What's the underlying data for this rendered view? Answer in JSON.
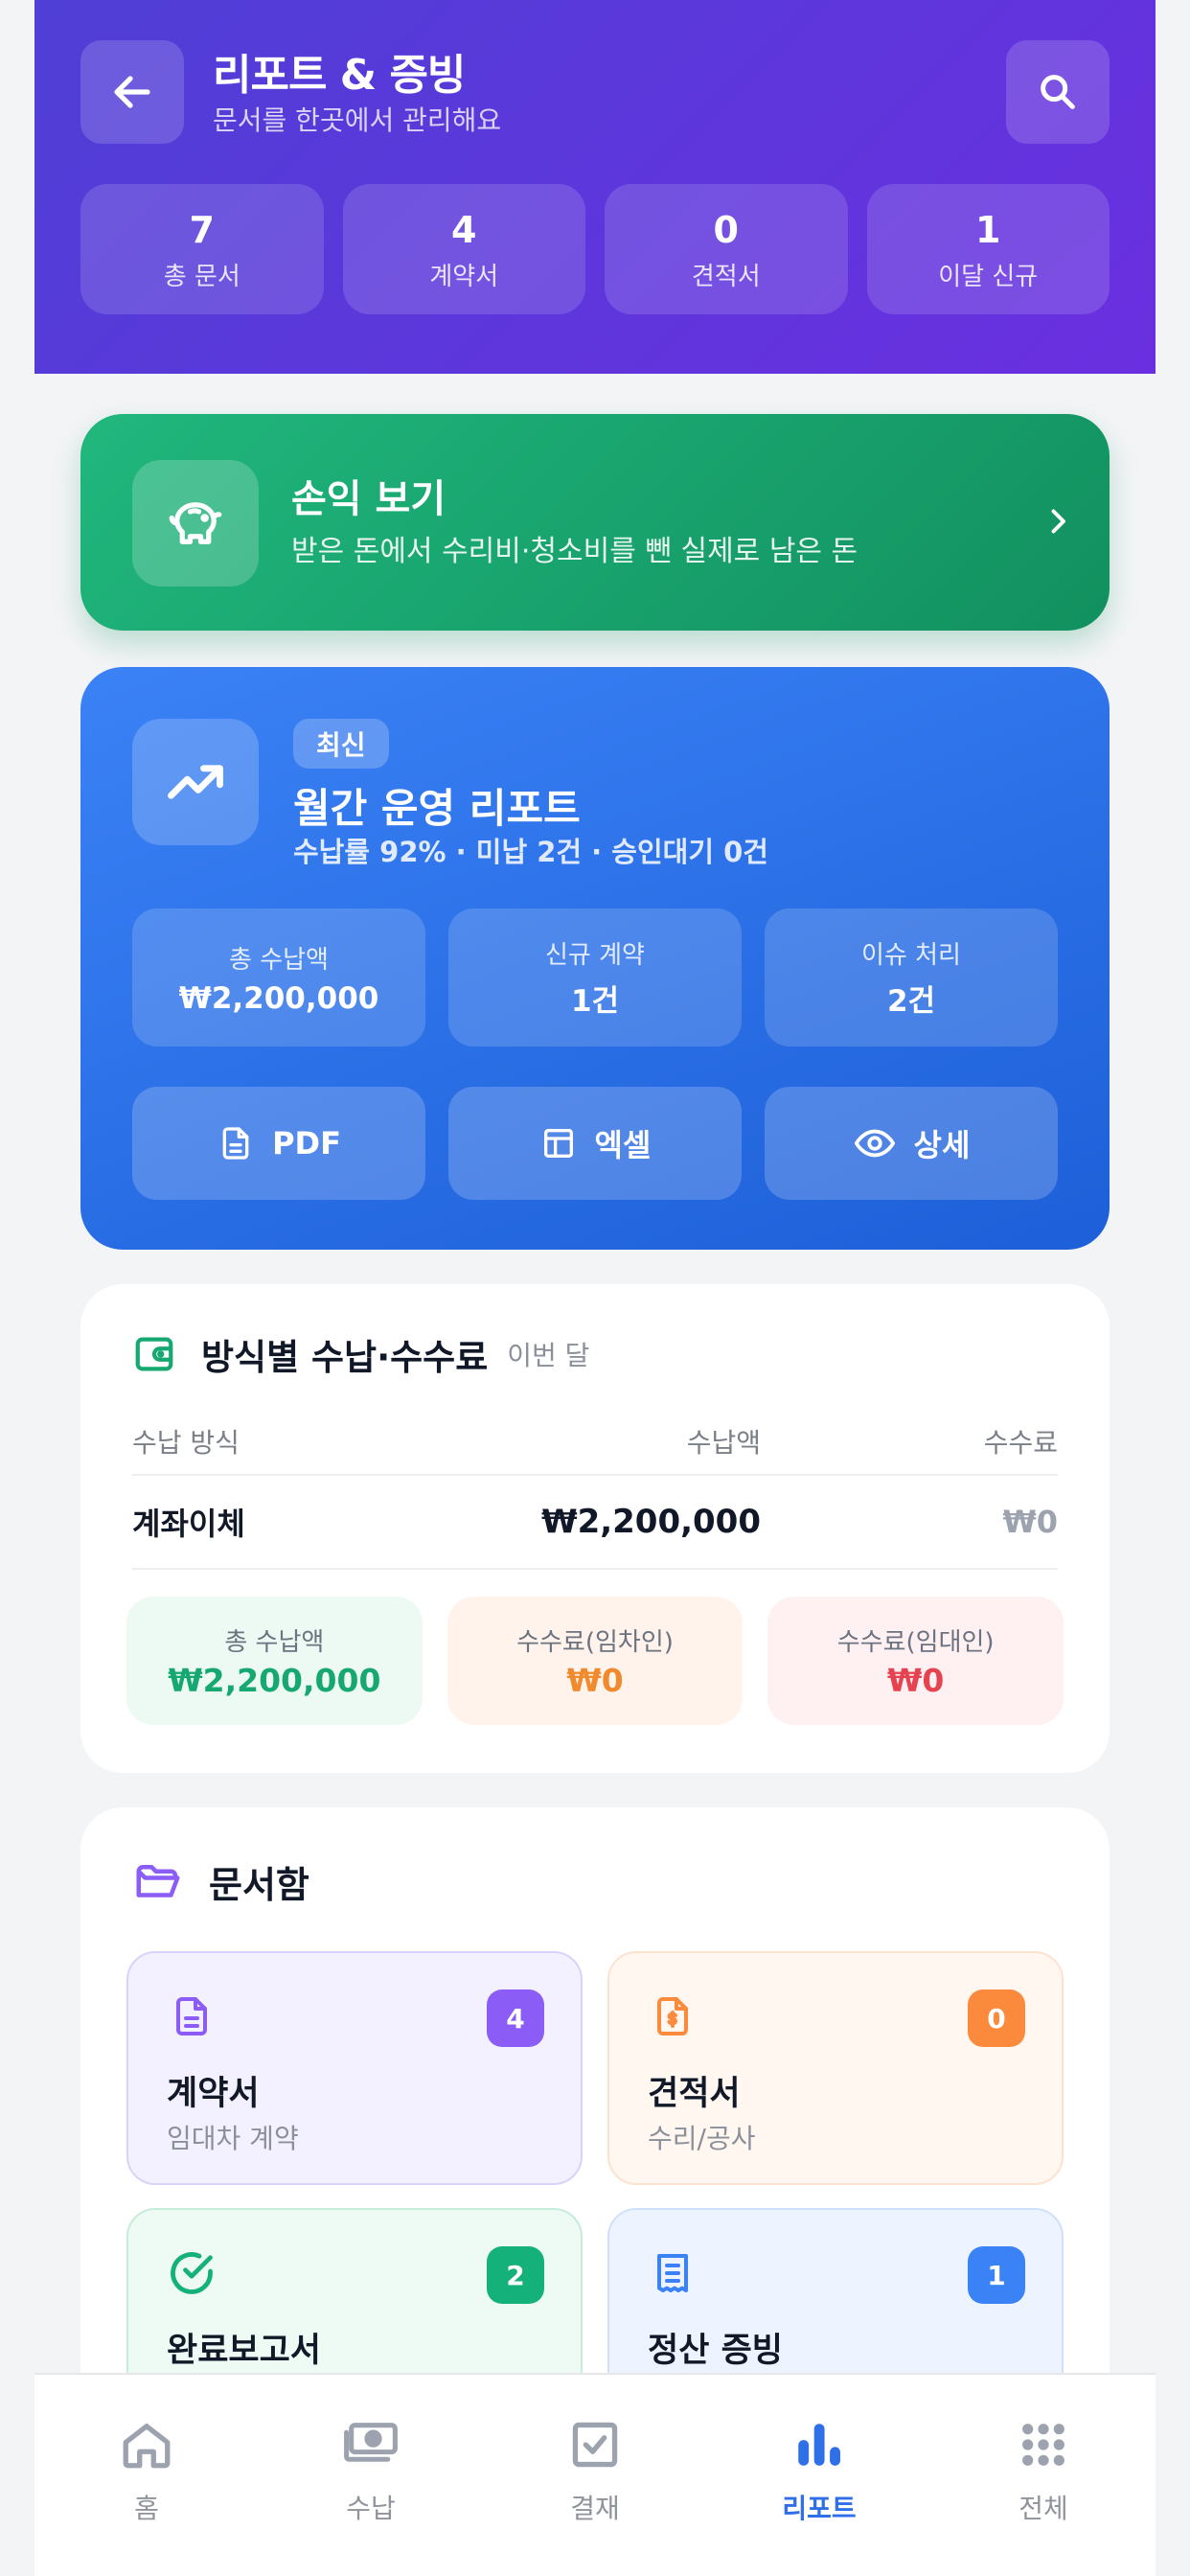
{
  "header": {
    "title": "리포트 & 증빙",
    "subtitle": "문서를 한곳에서 관리해요",
    "stats": [
      {
        "value": "7",
        "label": "총 문서"
      },
      {
        "value": "4",
        "label": "계약서"
      },
      {
        "value": "0",
        "label": "견적서"
      },
      {
        "value": "1",
        "label": "이달 신규"
      }
    ]
  },
  "profit_card": {
    "title": "손익 보기",
    "subtitle": "받은 돈에서 수리비·청소비를 뺀 실제로 남은 돈"
  },
  "report_card": {
    "badge": "최신",
    "title": "월간 운영 리포트",
    "subtitle": "수납률 92% · 미납 2건 · 승인대기 0건",
    "stats": [
      {
        "label": "총 수납액",
        "value": "₩2,200,000"
      },
      {
        "label": "신규 계약",
        "value": "1건"
      },
      {
        "label": "이슈 처리",
        "value": "2건"
      }
    ],
    "actions": [
      {
        "label": "PDF",
        "icon": "file-icon"
      },
      {
        "label": "엑셀",
        "icon": "table-icon"
      },
      {
        "label": "상세",
        "icon": "eye-icon"
      }
    ]
  },
  "methods_card": {
    "title": "방식별 수납·수수료",
    "period": "이번 달",
    "columns": [
      "수납 방식",
      "수납액",
      "수수료"
    ],
    "rows": [
      [
        "계좌이체",
        "₩2,200,000",
        "₩0"
      ]
    ],
    "summary": [
      {
        "label": "총 수납액",
        "value": "₩2,200,000"
      },
      {
        "label": "수수료(임차인)",
        "value": "₩0"
      },
      {
        "label": "수수료(임대인)",
        "value": "₩0"
      }
    ]
  },
  "docs_card": {
    "title": "문서함",
    "items": [
      {
        "title": "계약서",
        "subtitle": "임대차 계약",
        "count": "4"
      },
      {
        "title": "견적서",
        "subtitle": "수리/공사",
        "count": "0"
      },
      {
        "title": "완료보고서",
        "subtitle": "",
        "count": "2"
      },
      {
        "title": "정산 증빙",
        "subtitle": "",
        "count": "1"
      }
    ]
  },
  "nav": {
    "items": [
      {
        "label": "홈",
        "icon": "home-icon"
      },
      {
        "label": "수납",
        "icon": "money-icon"
      },
      {
        "label": "결재",
        "icon": "approval-icon"
      },
      {
        "label": "리포트",
        "icon": "chart-icon"
      },
      {
        "label": "전체",
        "icon": "grid-icon"
      }
    ],
    "active": "리포트"
  },
  "colors": {
    "header": "#5a35dc",
    "profit": "#1aa874",
    "report": "#2f6fe8",
    "active_nav": "#2f6fe8"
  }
}
